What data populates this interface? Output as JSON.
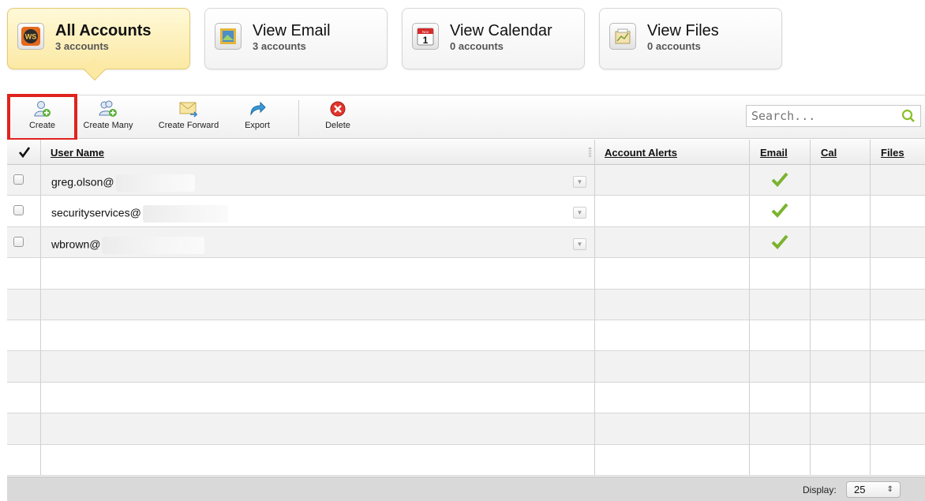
{
  "tabs": [
    {
      "title": "All Accounts",
      "sub": "3 accounts",
      "icon": "ws-logo-icon",
      "active": true
    },
    {
      "title": "View Email",
      "sub": "3 accounts",
      "icon": "email-stamp-icon",
      "active": false
    },
    {
      "title": "View Calendar",
      "sub": "0 accounts",
      "icon": "calendar-icon",
      "active": false
    },
    {
      "title": "View Files",
      "sub": "0 accounts",
      "icon": "files-icon",
      "active": false
    }
  ],
  "calendar_icon": {
    "month": "Nov",
    "day": "1"
  },
  "ws_logo": "WS",
  "toolbar": {
    "create": "Create",
    "create_many": "Create Many",
    "create_forward": "Create Forward",
    "export": "Export",
    "delete": "Delete"
  },
  "search": {
    "placeholder": "Search..."
  },
  "columns": {
    "user_name": "User Name",
    "account_alerts": "Account Alerts",
    "email": "Email",
    "cal": "Cal",
    "files": "Files"
  },
  "rows": [
    {
      "user": "greg.olson@",
      "email": true,
      "cal": false,
      "files": false
    },
    {
      "user": "securityservices@",
      "email": true,
      "cal": false,
      "files": false
    },
    {
      "user": "wbrown@",
      "email": true,
      "cal": false,
      "files": false
    }
  ],
  "empty_rows": 7,
  "colors": {
    "accent_tab": "#fbe9a4",
    "highlight": "#e0231e",
    "check": "#7ab32e"
  },
  "footer": {
    "display_label": "Display:",
    "display_value": "25"
  }
}
